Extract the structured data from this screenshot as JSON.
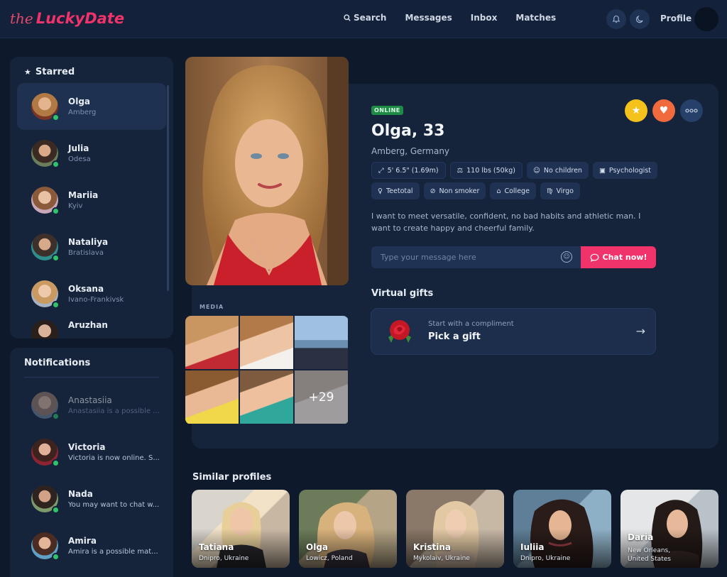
{
  "header": {
    "logo_prefix": "the",
    "logo_name": "LuckyDate",
    "nav": [
      "Search",
      "Messages",
      "Inbox",
      "Matches"
    ],
    "profile_label": "Profile"
  },
  "starred": {
    "title": "Starred",
    "items": [
      {
        "name": "Olga",
        "city": "Amberg"
      },
      {
        "name": "Julia",
        "city": "Odesa"
      },
      {
        "name": "Mariia",
        "city": "Kyiv"
      },
      {
        "name": "Nataliya",
        "city": "Bratislava"
      },
      {
        "name": "Oksana",
        "city": "Ivano-Frankivsk"
      },
      {
        "name": "Aruzhan",
        "city": ""
      }
    ]
  },
  "notifications": {
    "title": "Notifications",
    "items": [
      {
        "name": "Anastasiia",
        "text": "Anastasiia is a possible ..."
      },
      {
        "name": "Victoria",
        "text": "Victoria is now online. S..."
      },
      {
        "name": "Nada",
        "text": "You may want to chat w..."
      },
      {
        "name": "Amira",
        "text": "Amira is a possible mat..."
      }
    ]
  },
  "profile": {
    "status": "ONLINE",
    "name_age": "Olga, 33",
    "location": "Amberg, Germany",
    "tags_row1": [
      {
        "icon": "height-icon",
        "glyph": "⤢",
        "label": "5' 6.5\" (1.69m)"
      },
      {
        "icon": "weight-icon",
        "glyph": "⚖",
        "label": "110 lbs (50kg)"
      },
      {
        "icon": "children-icon",
        "glyph": "☺",
        "label": "No children"
      },
      {
        "icon": "briefcase-icon",
        "glyph": "▣",
        "label": "Psychologist"
      }
    ],
    "tags_row2": [
      {
        "icon": "glass-icon",
        "glyph": "♀",
        "label": "Teetotal"
      },
      {
        "icon": "no-smoking-icon",
        "glyph": "⊘",
        "label": "Non smoker"
      },
      {
        "icon": "education-icon",
        "glyph": "⌂",
        "label": "College"
      },
      {
        "icon": "zodiac-icon",
        "glyph": "♍",
        "label": "Virgo"
      }
    ],
    "bio": "I want to meet versatile, confident, no bad habits and athletic man. I want to create happy and cheerful family.",
    "message_placeholder": "Type your message here",
    "chat_label": "Chat now!"
  },
  "gifts": {
    "title": "Virtual gifts",
    "subtitle": "Start with a compliment",
    "cta": "Pick a gift"
  },
  "media": {
    "label": "MEDIA",
    "more": "+29"
  },
  "similar": {
    "title": "Similar profiles",
    "items": [
      {
        "name": "Tatiana",
        "loc": "Dnipro, Ukraine"
      },
      {
        "name": "Olga",
        "loc": "Lowicz, Poland"
      },
      {
        "name": "Kristina",
        "loc": "Mykolaiv, Ukraine"
      },
      {
        "name": "Iuliia",
        "loc": "Dnipro, Ukraine"
      },
      {
        "name": "Daria",
        "loc": "New Orleans, United States"
      }
    ]
  },
  "colors": {
    "background": "#0e1a2c",
    "panel": "#16243b",
    "accent": "#f0336a",
    "star": "#f5c21b",
    "heart": "#f06a3d",
    "online": "#2fc36a"
  }
}
